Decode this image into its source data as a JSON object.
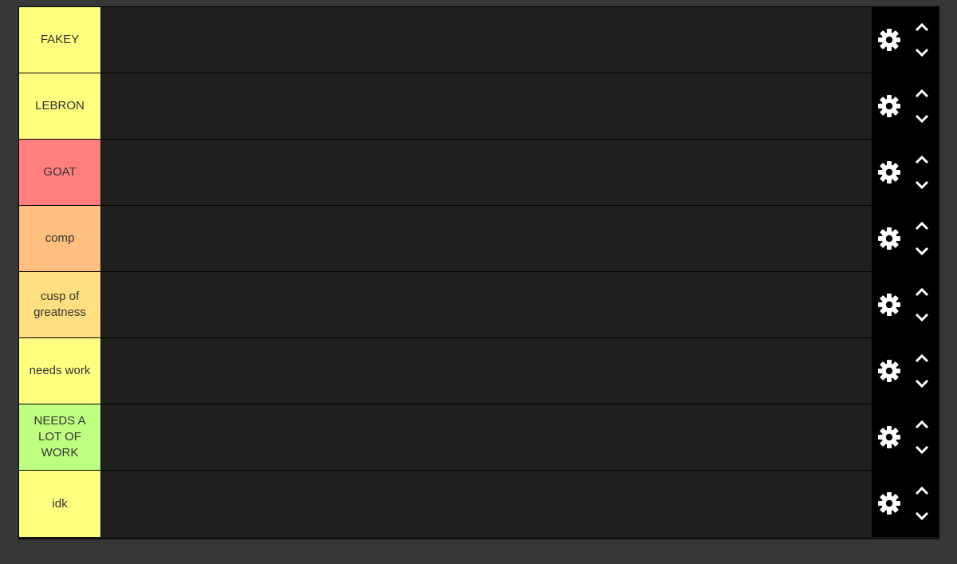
{
  "tiers": [
    {
      "label": "FAKEY",
      "color": "#ffff7f"
    },
    {
      "label": "LEBRON",
      "color": "#ffff7f"
    },
    {
      "label": "GOAT",
      "color": "#ff7f7f"
    },
    {
      "label": "comp",
      "color": "#ffbf7f"
    },
    {
      "label": "cusp of greatness",
      "color": "#ffdf7f"
    },
    {
      "label": "needs work",
      "color": "#ffff7f"
    },
    {
      "label": "NEEDS A LOT OF WORK",
      "color": "#bfff7f"
    },
    {
      "label": "idk",
      "color": "#ffff7f"
    }
  ],
  "icons": {
    "settings": "gear-icon",
    "move_up": "chevron-up-icon",
    "move_down": "chevron-down-icon"
  },
  "colors": {
    "background": "#363636",
    "row_area": "#1f1f1d",
    "controls": "#000000"
  }
}
